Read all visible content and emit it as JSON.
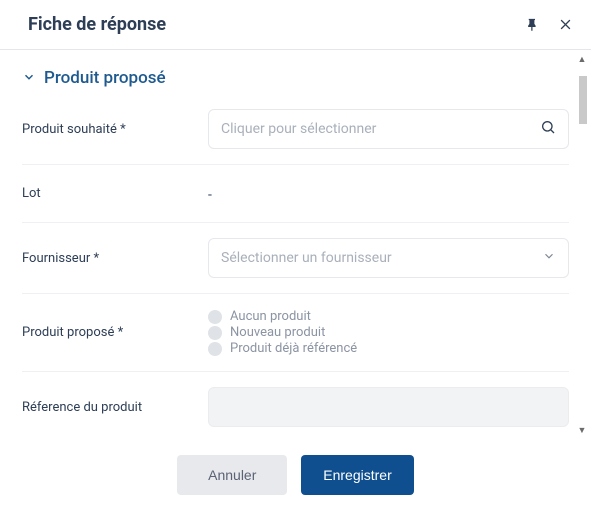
{
  "header": {
    "title": "Fiche de réponse"
  },
  "section": {
    "title": "Produit proposé"
  },
  "fields": {
    "desired_product": {
      "label": "Produit souhaité *",
      "placeholder": "Cliquer pour sélectionner"
    },
    "lot": {
      "label": "Lot",
      "value": "-"
    },
    "supplier": {
      "label": "Fournisseur *",
      "placeholder": "Sélectionner un fournisseur"
    },
    "proposed_product": {
      "label": "Produit proposé *",
      "options": {
        "none": "Aucun produit",
        "new": "Nouveau produit",
        "existing": "Produit déjà référencé"
      }
    },
    "product_reference": {
      "label": "Réference du produit"
    }
  },
  "footer": {
    "cancel": "Annuler",
    "save": "Enregistrer"
  }
}
